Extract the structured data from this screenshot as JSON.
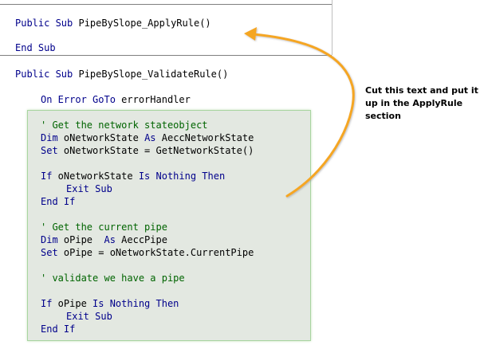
{
  "code": {
    "apply_rule_sub": {
      "kw": "Public Sub",
      "name": " PipeBySlope_ApplyRule()"
    },
    "end_sub": "End Sub",
    "validate_rule_sub": {
      "kw": "Public Sub",
      "name": " PipeBySlope_ValidateRule()"
    },
    "on_error": {
      "kw": "On Error GoTo",
      "rest": " errorHandler"
    },
    "highlighted": {
      "comment_network": "' Get the network stateobject",
      "dim_network": {
        "kw": "Dim",
        "mid": " oNetworkState ",
        "kw2": "As",
        "rest": " AeccNetworkState"
      },
      "set_network": {
        "kw": "Set",
        "rest": " oNetworkState = GetNetworkState()"
      },
      "if_network": {
        "kw": "If",
        "mid": " oNetworkState ",
        "kw2": "Is Nothing Then"
      },
      "exit_sub_1": "Exit Sub",
      "end_if_1": "End If",
      "comment_pipe": "' Get the current pipe",
      "dim_pipe": {
        "kw": "Dim",
        "mid": " oPipe  ",
        "kw2": "As",
        "rest": " AeccPipe"
      },
      "set_pipe": {
        "kw": "Set",
        "rest": " oPipe = oNetworkState.CurrentPipe"
      },
      "comment_validate": "' validate we have a pipe",
      "if_pipe": {
        "kw": "If",
        "mid": " oPipe ",
        "kw2": "Is Nothing Then"
      },
      "exit_sub_2": "Exit Sub",
      "end_if_2": "End If"
    }
  },
  "annotation": {
    "text": "Cut this text and put it up in the ApplyRule section"
  },
  "colors": {
    "keyword": "#00008b",
    "comment": "#006400",
    "highlight_fill": "#e3e8e1",
    "highlight_border": "#a8d5a0",
    "arrow": "#f5a623"
  }
}
